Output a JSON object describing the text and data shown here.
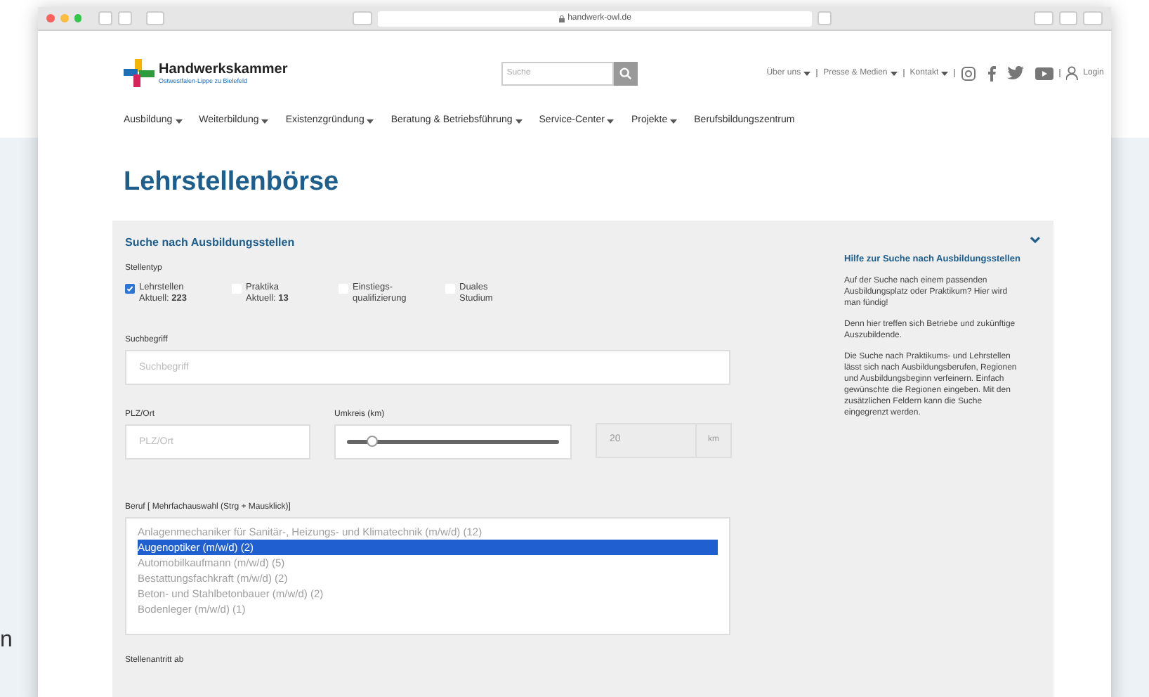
{
  "background_text": "n",
  "browser": {
    "url": "handwerk-owl.de"
  },
  "header": {
    "logo": {
      "name": "Handwerkskammer",
      "subtitle": "Ostwestfalen-Lippe zu Bielefeld"
    },
    "search": {
      "placeholder": "Suche"
    },
    "top_links": [
      {
        "label": "Über uns",
        "dropdown": true
      },
      {
        "label": "Presse & Medien",
        "dropdown": true
      },
      {
        "label": "Kontakt",
        "dropdown": true
      }
    ],
    "login": "Login"
  },
  "nav": [
    {
      "label": "Ausbildung",
      "dropdown": true
    },
    {
      "label": "Weiterbildung",
      "dropdown": true
    },
    {
      "label": "Existenzgründung",
      "dropdown": true
    },
    {
      "label": "Beratung & Betriebsführung",
      "dropdown": true
    },
    {
      "label": "Service-Center",
      "dropdown": true
    },
    {
      "label": "Projekte",
      "dropdown": true
    },
    {
      "label": "Berufsbildungszentrum",
      "dropdown": false
    }
  ],
  "page_title": "Lehrstellenbörse",
  "search_panel": {
    "title": "Suche nach Ausbildungsstellen",
    "type_label": "Stellentyp",
    "types": [
      {
        "line1": "Lehrstellen",
        "line2": "Aktuell: **223**",
        "checked": true
      },
      {
        "line1": "Praktika",
        "line2": "Aktuell: **13**",
        "checked": false
      },
      {
        "line1": "Einstiegs-",
        "line2": "qualifizierung",
        "checked": false
      },
      {
        "line1": "Duales",
        "line2": "Studium",
        "checked": false
      }
    ],
    "keyword": {
      "label": "Suchbegriff",
      "placeholder": "Suchbegriff"
    },
    "location": {
      "label": "PLZ/Ort",
      "placeholder": "PLZ/Ort"
    },
    "radius": {
      "label": "Umkreis (km)",
      "level": 0.12,
      "value": "20",
      "unit": "km"
    },
    "profession": {
      "label": "Beruf [ Mehrfachauswahl (Strg + Mausklick)]",
      "options": [
        {
          "label": "Anlagenmechaniker für Sanitär-, Heizungs- und Klimatechnik (m/w/d) (12)",
          "selected": false
        },
        {
          "label": "Augenoptiker (m/w/d) (2)",
          "selected": true
        },
        {
          "label": "Automobilkaufmann (m/w/d) (5)",
          "selected": false
        },
        {
          "label": "Bestattungsfachkraft (m/w/d) (2)",
          "selected": false
        },
        {
          "label": "Beton- und Stahlbetonbauer (m/w/d) (2)",
          "selected": false
        },
        {
          "label": "Bodenleger (m/w/d) (1)",
          "selected": false
        }
      ]
    },
    "start_label": "Stellenantritt ab"
  },
  "help": {
    "title": "Hilfe zur Suche nach Ausbildungsstellen",
    "paragraphs": [
      "Auf der Suche nach einem passenden Ausbildungsplatz oder Praktikum? Hier wird man fündig!",
      "Denn hier treffen sich Betriebe und zukünftige Auszubildende.",
      "Die Suche nach Praktikums- und Lehrstellen lässt sich nach Ausbildungsberufen, Regionen und Ausbildungsbeginn verfeinern. Einfach gewünschte die Regionen eingeben. Mit den zusätzlichen Feldern kann die Suche eingegrenzt werden."
    ]
  }
}
